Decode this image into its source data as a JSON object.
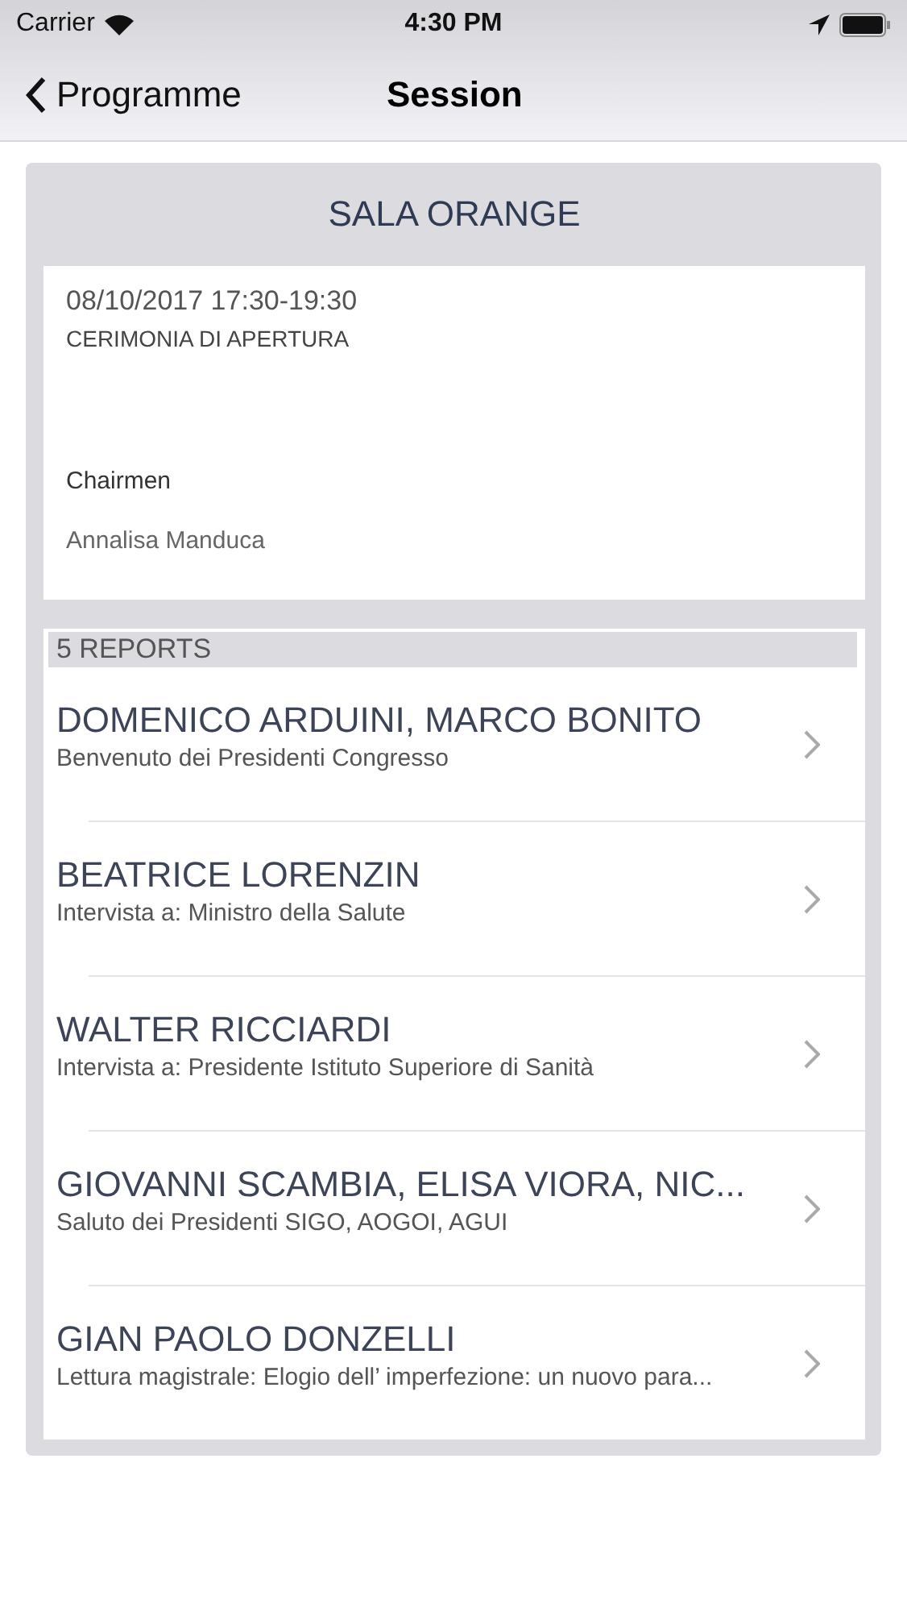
{
  "status_bar": {
    "carrier": "Carrier",
    "time": "4:30 PM"
  },
  "nav": {
    "back": "Programme",
    "title": "Session"
  },
  "room": "SALA ORANGE",
  "session": {
    "datetime": "08/10/2017 17:30-19:30",
    "title": "CERIMONIA DI APERTURA",
    "chair_label": "Chairmen",
    "chair": "Annalisa Manduca"
  },
  "reports": {
    "header": "5 REPORTS",
    "items": [
      {
        "speakers": "DOMENICO ARDUINI, MARCO BONITO",
        "title": "Benvenuto dei Presidenti Congresso"
      },
      {
        "speakers": "BEATRICE LORENZIN",
        "title": "Intervista a: Ministro della Salute"
      },
      {
        "speakers": "WALTER RICCIARDI",
        "title": "Intervista a: Presidente Istituto Superiore di Sanità"
      },
      {
        "speakers": "GIOVANNI SCAMBIA, ELISA VIORA, NIC...",
        "title": "Saluto dei Presidenti SIGO, AOGOI, AGUI"
      },
      {
        "speakers": "GIAN PAOLO DONZELLI",
        "title": "Lettura magistrale: Elogio dell’ imperfezione: un nuovo para..."
      }
    ]
  }
}
